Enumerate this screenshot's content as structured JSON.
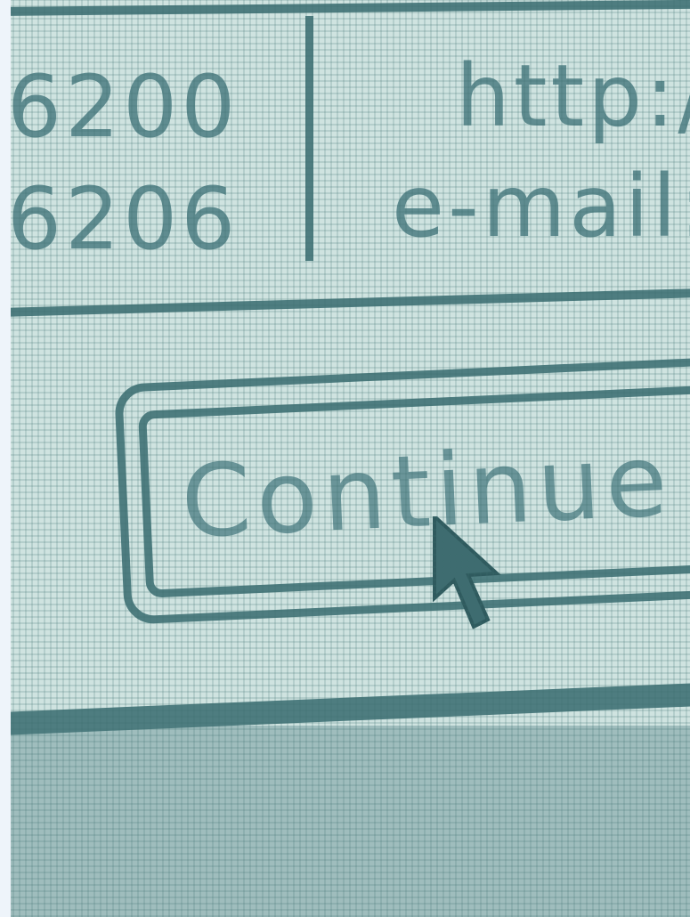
{
  "contact_table": {
    "numbers": [
      "6200",
      "6206"
    ],
    "links": [
      "http:/",
      "e-mail:"
    ]
  },
  "dialog": {
    "continue_button_label": "Continue"
  },
  "colors": {
    "background": "#cfe3e0",
    "lines": "#4e7d80",
    "text": "#5f8c90",
    "bottom_band": "#9fbdbd"
  },
  "icons": {
    "cursor": "mouse-pointer-arrow-icon"
  }
}
